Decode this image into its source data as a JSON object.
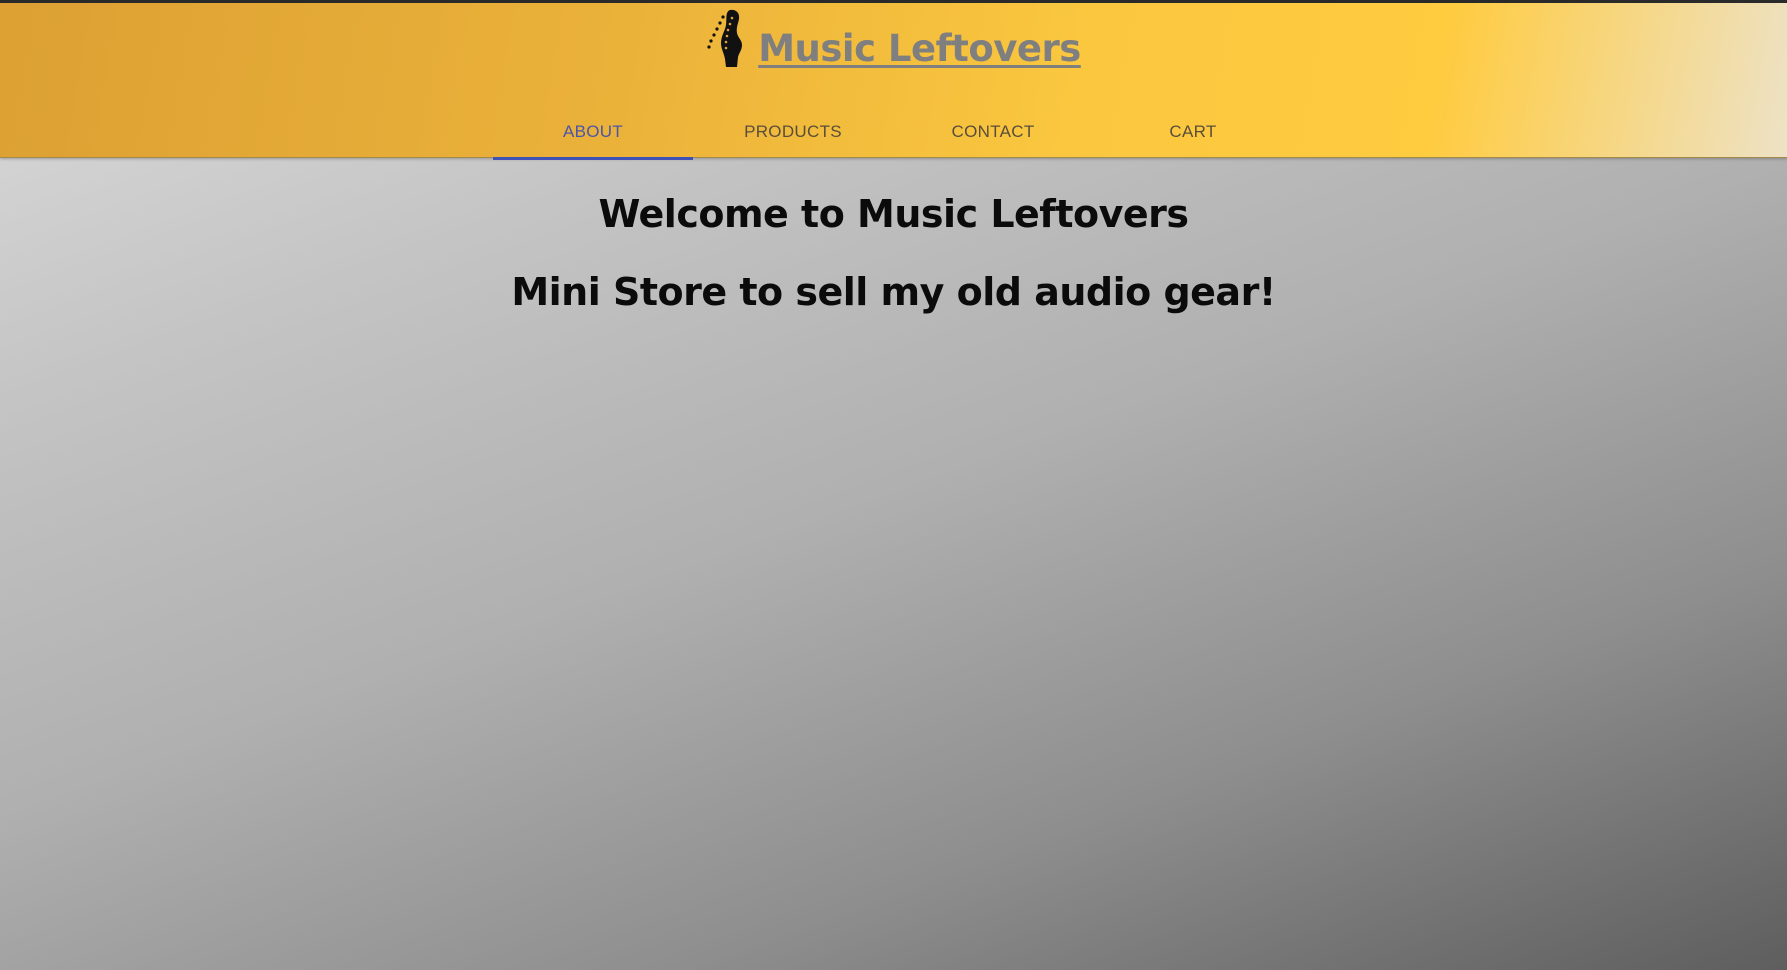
{
  "header": {
    "brand_title": "Music Leftovers",
    "brand_icon": "guitar-headstock-icon"
  },
  "nav": {
    "tabs": [
      {
        "label": "ABOUT",
        "active": true
      },
      {
        "label": "PRODUCTS",
        "active": false
      },
      {
        "label": "CONTACT",
        "active": false
      },
      {
        "label": "CART",
        "active": false
      }
    ]
  },
  "main": {
    "heading": "Welcome to Music Leftovers",
    "subheading": "Mini Store to sell my old audio gear!"
  },
  "colors": {
    "accent": "#3f51b5",
    "header_gold": "#ffcb3f",
    "brand_text": "#7f7f7f"
  }
}
